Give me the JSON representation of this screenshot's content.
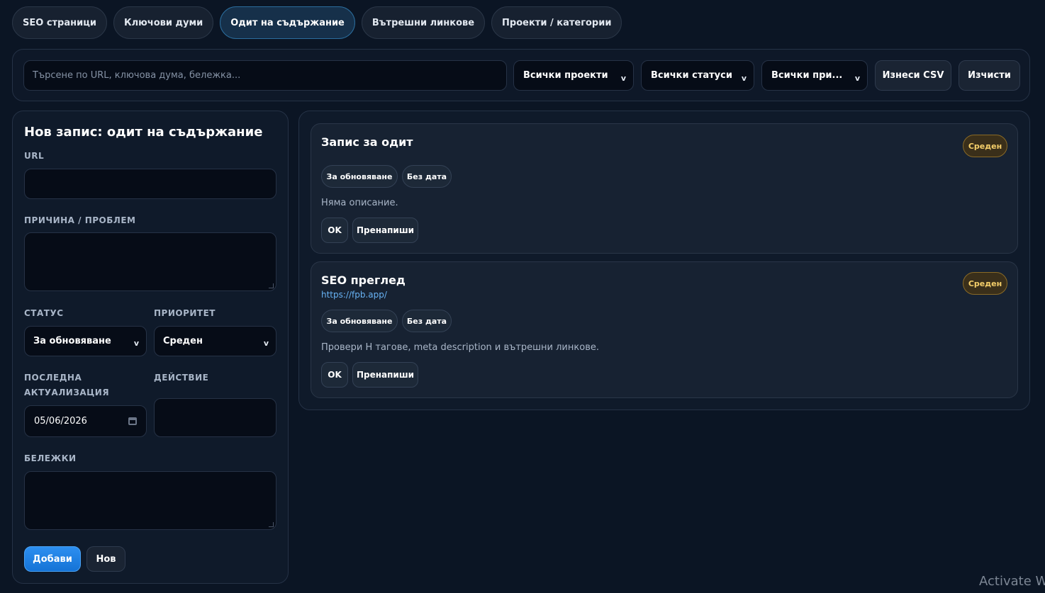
{
  "tabs": [
    {
      "label": "SEO страници"
    },
    {
      "label": "Ключови думи"
    },
    {
      "label": "Одит на съдържание",
      "active": true
    },
    {
      "label": "Вътрешни линкове"
    },
    {
      "label": "Проекти / категории"
    }
  ],
  "filters": {
    "search_placeholder": "Търсене по URL, ключова дума, бележка...",
    "projects_select": "Всички проекти",
    "statuses_select": "Всички статуси",
    "priorities_select": "Всички при...",
    "export_label": "Изнеси CSV",
    "clear_label": "Изчисти"
  },
  "form": {
    "title": "Нов запис: одит на съдържание",
    "url_label": "URL",
    "url_value": "",
    "reason_label": "ПРИЧИНА / ПРОБЛЕМ",
    "status_label": "СТАТУС",
    "status_value": "За обновяване",
    "priority_label": "ПРИОРИТЕТ",
    "priority_value": "Среден",
    "last_update_label_line1": "ПОСЛЕДНА",
    "last_update_label_line2": "АКТУАЛИЗАЦИЯ",
    "last_update_value": "05/06/2026",
    "action_label": "ДЕЙСТВИЕ",
    "notes_label": "БЕЛЕЖКИ",
    "add_label": "Добави",
    "new_label": "Нов"
  },
  "records": [
    {
      "title": "Запис за одит",
      "url": "",
      "priority": "Среден",
      "status": "За обновяване",
      "date": "Без дата",
      "description": "Няма описание.",
      "ok_label": "OK",
      "rewrite_label": "Пренапиши"
    },
    {
      "title": "SEO преглед",
      "url": "https://fpb.app/",
      "priority": "Среден",
      "status": "За обновяване",
      "date": "Без дата",
      "description": "Провери H тагове, meta description и вътрешни линкове.",
      "ok_label": "OK",
      "rewrite_label": "Пренапиши"
    }
  ],
  "watermark": "Activate W",
  "colors": {
    "background": "#0b1524",
    "accent": "#1f86ea",
    "priority_badge": "#f5cf6a",
    "link": "#68b3f5"
  }
}
